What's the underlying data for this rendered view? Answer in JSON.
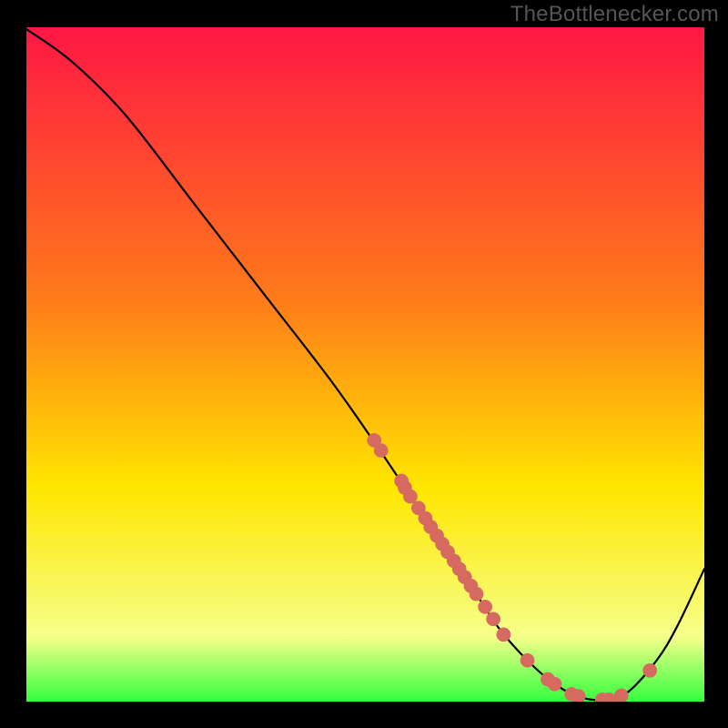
{
  "watermark": "TheBottlenecker.com",
  "colors": {
    "gradient_top": "#ff1744",
    "gradient_mid1": "#ff7a1a",
    "gradient_mid2": "#ffe600",
    "gradient_mid3": "#f6ff8a",
    "gradient_bottom": "#2aff3a",
    "curve": "#000000",
    "dot": "#d76a60"
  },
  "chart_data": {
    "type": "line",
    "title": "",
    "xlabel": "",
    "ylabel": "",
    "xlim": [
      0,
      1
    ],
    "ylim": [
      0,
      1
    ],
    "x": [
      0.0,
      0.07,
      0.15,
      0.25,
      0.35,
      0.45,
      0.52,
      0.57,
      0.62,
      0.67,
      0.7,
      0.74,
      0.78,
      0.82,
      0.86,
      0.89,
      0.93,
      0.96,
      1.0
    ],
    "y_curve": [
      1.0,
      0.95,
      0.87,
      0.74,
      0.61,
      0.48,
      0.38,
      0.305,
      0.23,
      0.155,
      0.11,
      0.065,
      0.03,
      0.01,
      0.007,
      0.02,
      0.065,
      0.115,
      0.2
    ],
    "dots": [
      {
        "x": 0.515,
        "y": 0.39
      },
      {
        "x": 0.525,
        "y": 0.375
      },
      {
        "x": 0.555,
        "y": 0.33
      },
      {
        "x": 0.56,
        "y": 0.32
      },
      {
        "x": 0.568,
        "y": 0.307
      },
      {
        "x": 0.58,
        "y": 0.29
      },
      {
        "x": 0.59,
        "y": 0.275
      },
      {
        "x": 0.598,
        "y": 0.262
      },
      {
        "x": 0.607,
        "y": 0.249
      },
      {
        "x": 0.615,
        "y": 0.237
      },
      {
        "x": 0.623,
        "y": 0.225
      },
      {
        "x": 0.632,
        "y": 0.212
      },
      {
        "x": 0.64,
        "y": 0.2
      },
      {
        "x": 0.648,
        "y": 0.188
      },
      {
        "x": 0.657,
        "y": 0.175
      },
      {
        "x": 0.665,
        "y": 0.163
      },
      {
        "x": 0.678,
        "y": 0.144
      },
      {
        "x": 0.69,
        "y": 0.126
      },
      {
        "x": 0.705,
        "y": 0.103
      },
      {
        "x": 0.74,
        "y": 0.065
      },
      {
        "x": 0.77,
        "y": 0.037
      },
      {
        "x": 0.78,
        "y": 0.03
      },
      {
        "x": 0.805,
        "y": 0.015
      },
      {
        "x": 0.815,
        "y": 0.012
      },
      {
        "x": 0.85,
        "y": 0.007
      },
      {
        "x": 0.86,
        "y": 0.007
      },
      {
        "x": 0.878,
        "y": 0.013
      },
      {
        "x": 0.92,
        "y": 0.05
      }
    ]
  }
}
